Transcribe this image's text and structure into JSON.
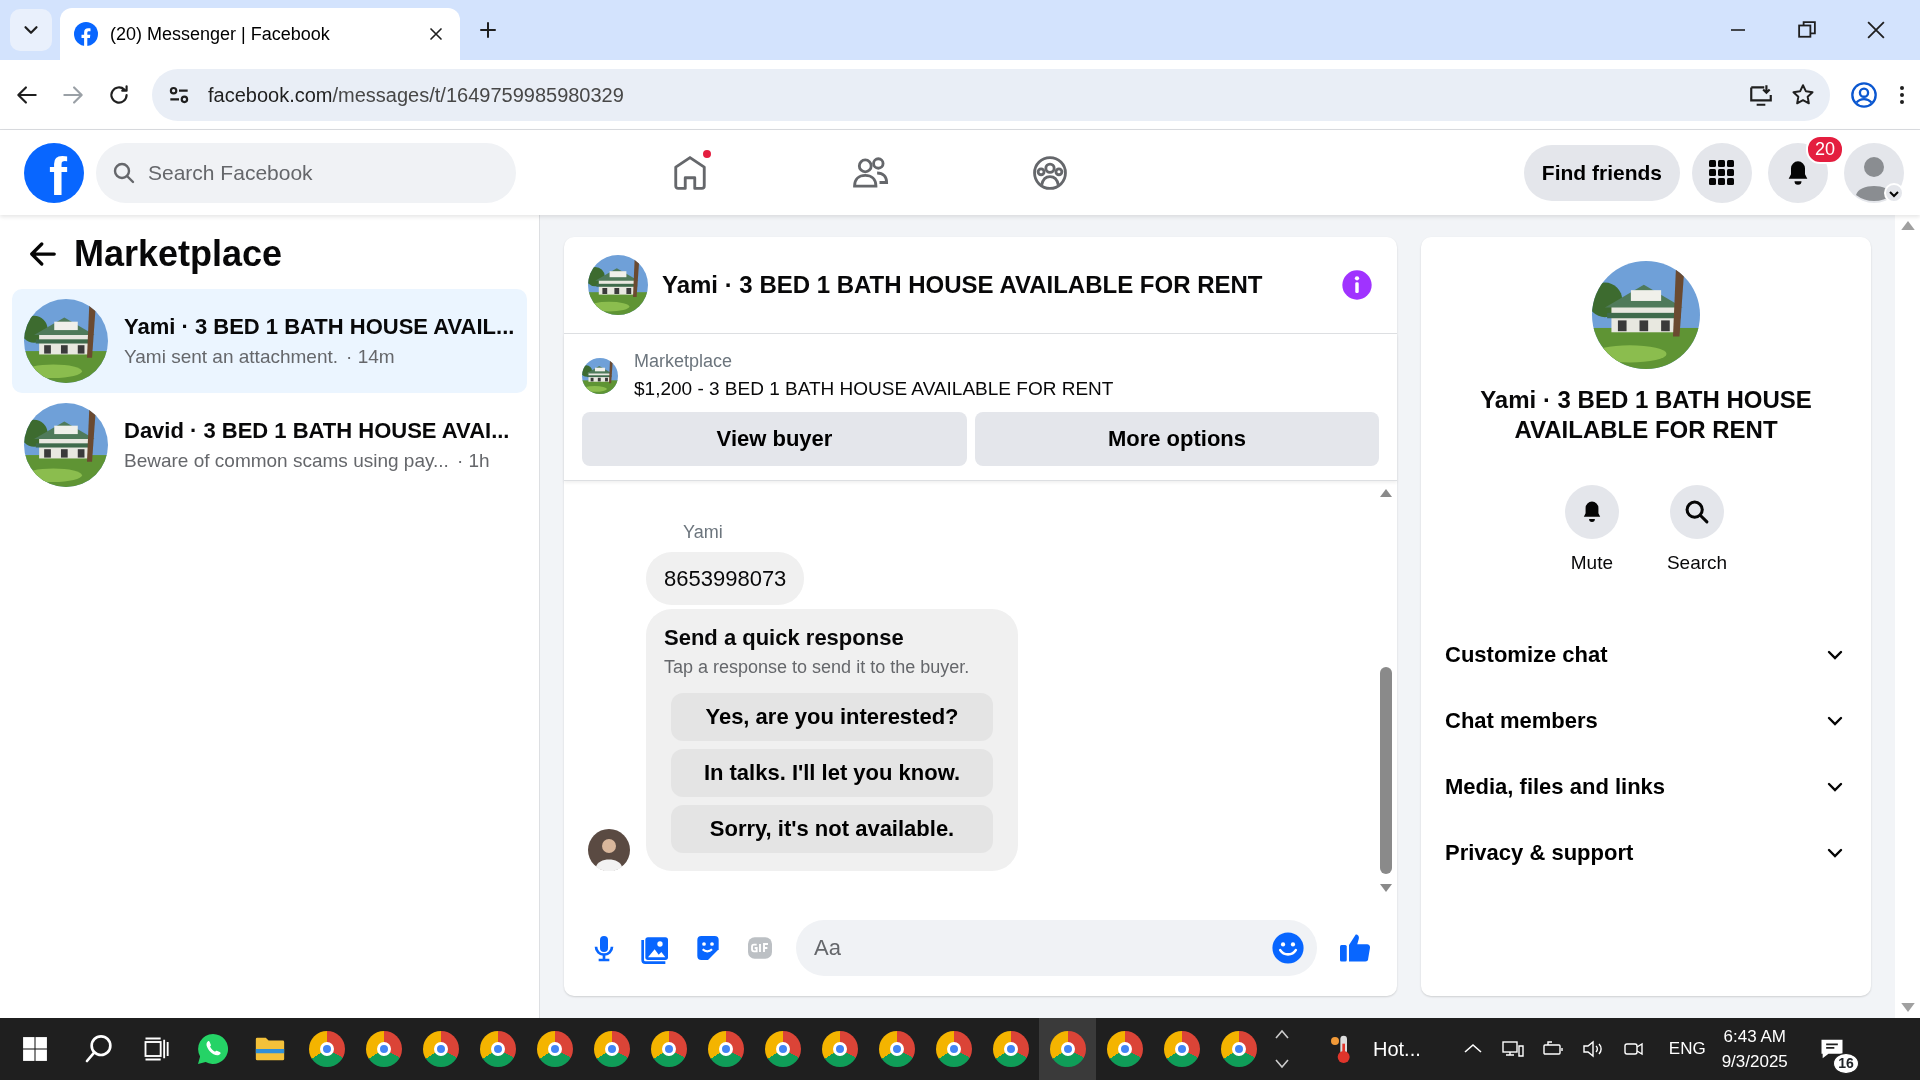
{
  "browser": {
    "tabs": [
      {
        "title": "(20) Messenger | Facebook",
        "selected": true
      }
    ],
    "url_host": "facebook.com",
    "url_path": "/messages/t/1649759985980329"
  },
  "header": {
    "logo": "f",
    "search": {
      "placeholder": "Search Facebook"
    },
    "nav": [
      {
        "kind": "home",
        "dot": true
      },
      {
        "kind": "friends",
        "dot": false
      },
      {
        "kind": "groups",
        "dot": false
      }
    ],
    "find_friends": "Find friends",
    "notification_count": "20"
  },
  "sidebar": {
    "title": "Marketplace",
    "conversations": [
      {
        "name": "Yami · 3 BED 1 BATH HOUSE AVAIL...",
        "preview": "Yami sent an attachment.",
        "time": "· 14m",
        "selected": true
      },
      {
        "name": "David · 3 BED 1 BATH HOUSE AVAI...",
        "preview": "Beware of common scams using pay...",
        "time": "· 1h",
        "selected": false
      }
    ]
  },
  "chat": {
    "title": "Yami · 3 BED 1 BATH HOUSE AVAILABLE FOR RENT",
    "listing": {
      "label": "Marketplace",
      "text": "$1,200 - 3 BED 1 BATH HOUSE AVAILABLE FOR RENT"
    },
    "buttons": [
      "View buyer",
      "More options"
    ],
    "sender": "Yami",
    "message": "8653998073",
    "quick_response": {
      "title": "Send a quick response",
      "subtitle": "Tap a response to send it to the buyer.",
      "options": [
        "Yes, are you interested?",
        "In talks. I'll let you know.",
        "Sorry, it's not available."
      ]
    },
    "composer": {
      "placeholder": "Aa"
    }
  },
  "details": {
    "title": "Yami · 3 BED 1 BATH HOUSE AVAILABLE FOR RENT",
    "actions": [
      {
        "kind": "mute",
        "label": "Mute"
      },
      {
        "kind": "search",
        "label": "Search"
      }
    ],
    "sections": [
      {
        "label": "Customize chat",
        "expanded": false
      },
      {
        "label": "Chat members",
        "expanded": false
      },
      {
        "label": "Media, files and links",
        "expanded": false
      },
      {
        "label": "Privacy & support",
        "expanded": false
      }
    ]
  },
  "taskbar": {
    "apps": [
      {
        "kind": "whatsapp",
        "selected": false
      },
      {
        "kind": "files",
        "selected": false
      },
      {
        "kind": "browser",
        "selected": false
      },
      {
        "kind": "browser",
        "selected": false
      },
      {
        "kind": "browser",
        "selected": false
      },
      {
        "kind": "browser",
        "selected": false
      },
      {
        "kind": "browser",
        "selected": false
      },
      {
        "kind": "browser",
        "selected": false
      },
      {
        "kind": "browser",
        "selected": false
      },
      {
        "kind": "browser",
        "selected": false
      },
      {
        "kind": "browser",
        "selected": false
      },
      {
        "kind": "browser",
        "selected": false
      },
      {
        "kind": "browser",
        "selected": false
      },
      {
        "kind": "browser",
        "selected": false
      },
      {
        "kind": "browser",
        "selected": false
      },
      {
        "kind": "browser",
        "selected": true
      },
      {
        "kind": "browser",
        "selected": false
      },
      {
        "kind": "browser",
        "selected": false
      },
      {
        "kind": "browser",
        "selected": false
      }
    ],
    "weather": "Hot...",
    "language": "ENG",
    "time": "6:43 AM",
    "date": "9/3/2025",
    "notifications": "16"
  }
}
